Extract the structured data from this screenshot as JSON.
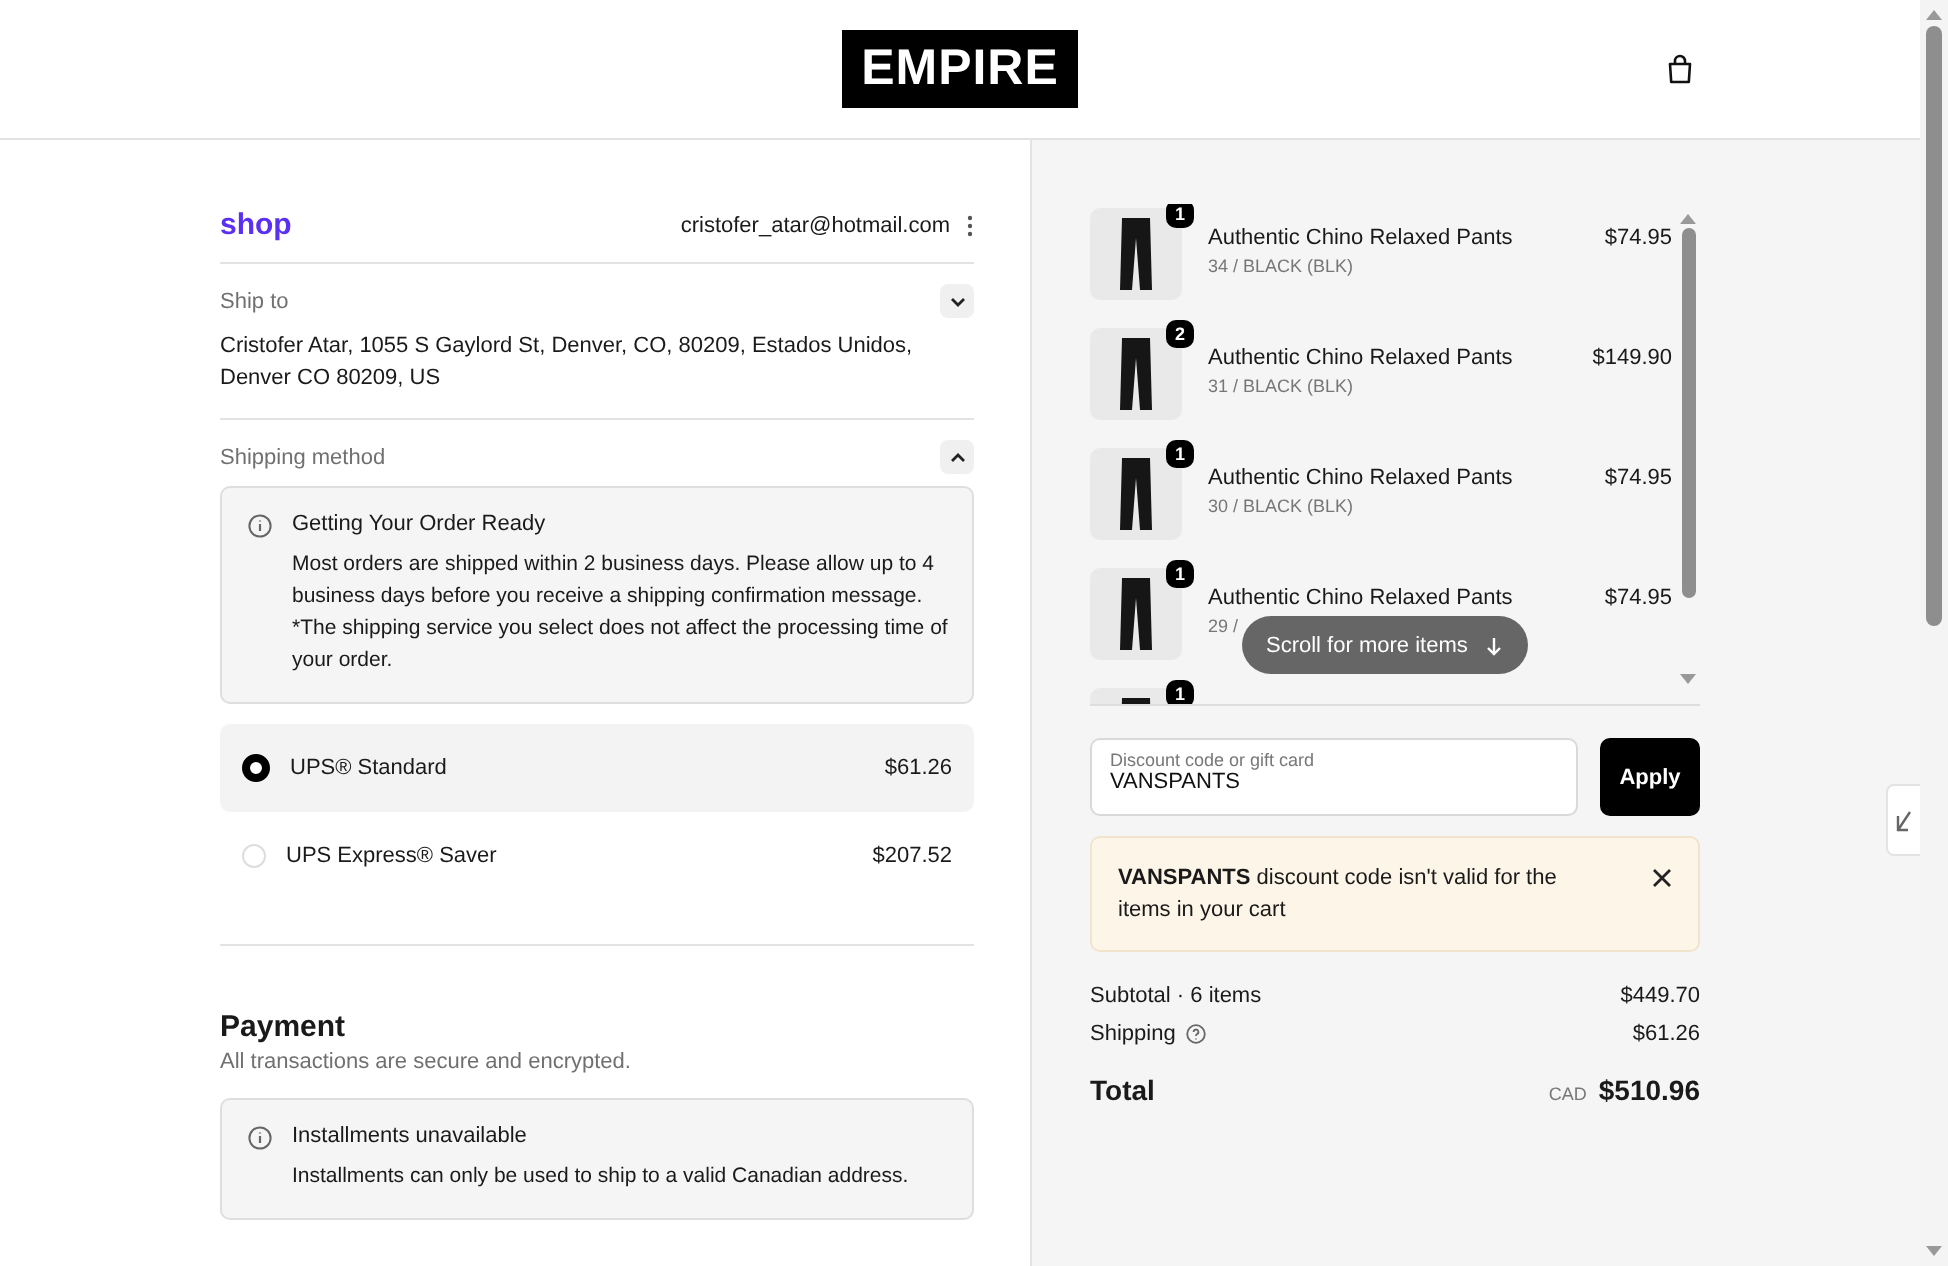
{
  "header": {
    "logo": "EMPIRE"
  },
  "account": {
    "brand": "shop",
    "email": "cristofer_atar@hotmail.com"
  },
  "ship_to": {
    "label": "Ship to",
    "expanded": false,
    "lines": [
      "Cristofer Atar, 1055 S Gaylord St, Denver, CO, 80209, Estados Unidos,",
      "Denver CO 80209, US"
    ]
  },
  "shipping_method": {
    "label": "Shipping method",
    "expanded": true,
    "notice": {
      "title": "Getting Your Order Ready",
      "body": "Most orders are shipped within 2 business days. Please allow up to 4 business days before you receive a shipping confirmation message. *The shipping service you select does not affect the processing time of your order."
    },
    "options": [
      {
        "name": "UPS® Standard",
        "price": "$61.26",
        "selected": true
      },
      {
        "name": "UPS Express® Saver",
        "price": "$207.52",
        "selected": false
      }
    ]
  },
  "payment": {
    "title": "Payment",
    "subtitle": "All transactions are secure and encrypted.",
    "notice": {
      "title": "Installments unavailable",
      "body": "Installments can only be used to ship to a valid Canadian address."
    }
  },
  "cart": {
    "items": [
      {
        "quantity": "1",
        "name": "Authentic Chino Relaxed Pants",
        "variant": "34 / BLACK (BLK)",
        "price": "$74.95"
      },
      {
        "quantity": "2",
        "name": "Authentic Chino Relaxed Pants",
        "variant": "31 / BLACK (BLK)",
        "price": "$149.90"
      },
      {
        "quantity": "1",
        "name": "Authentic Chino Relaxed Pants",
        "variant": "30 / BLACK (BLK)",
        "price": "$74.95"
      },
      {
        "quantity": "1",
        "name": "Authentic Chino Relaxed Pants",
        "variant": "29 /",
        "price": "$74.95"
      },
      {
        "quantity": "1"
      }
    ],
    "scroll_hint": "Scroll for more items"
  },
  "discount": {
    "placeholder": "Discount code or gift card",
    "value": "VANSPANTS",
    "button": "Apply"
  },
  "error": {
    "message": "**VANSPANTS** discount code isn't valid for the items in your cart"
  },
  "summary": {
    "subtotal_label": "Subtotal · 6 items",
    "subtotal": "$449.70",
    "shipping_label": "Shipping",
    "shipping": "$61.26",
    "total_label": "Total",
    "currency": "CAD",
    "total": "$510.96"
  }
}
